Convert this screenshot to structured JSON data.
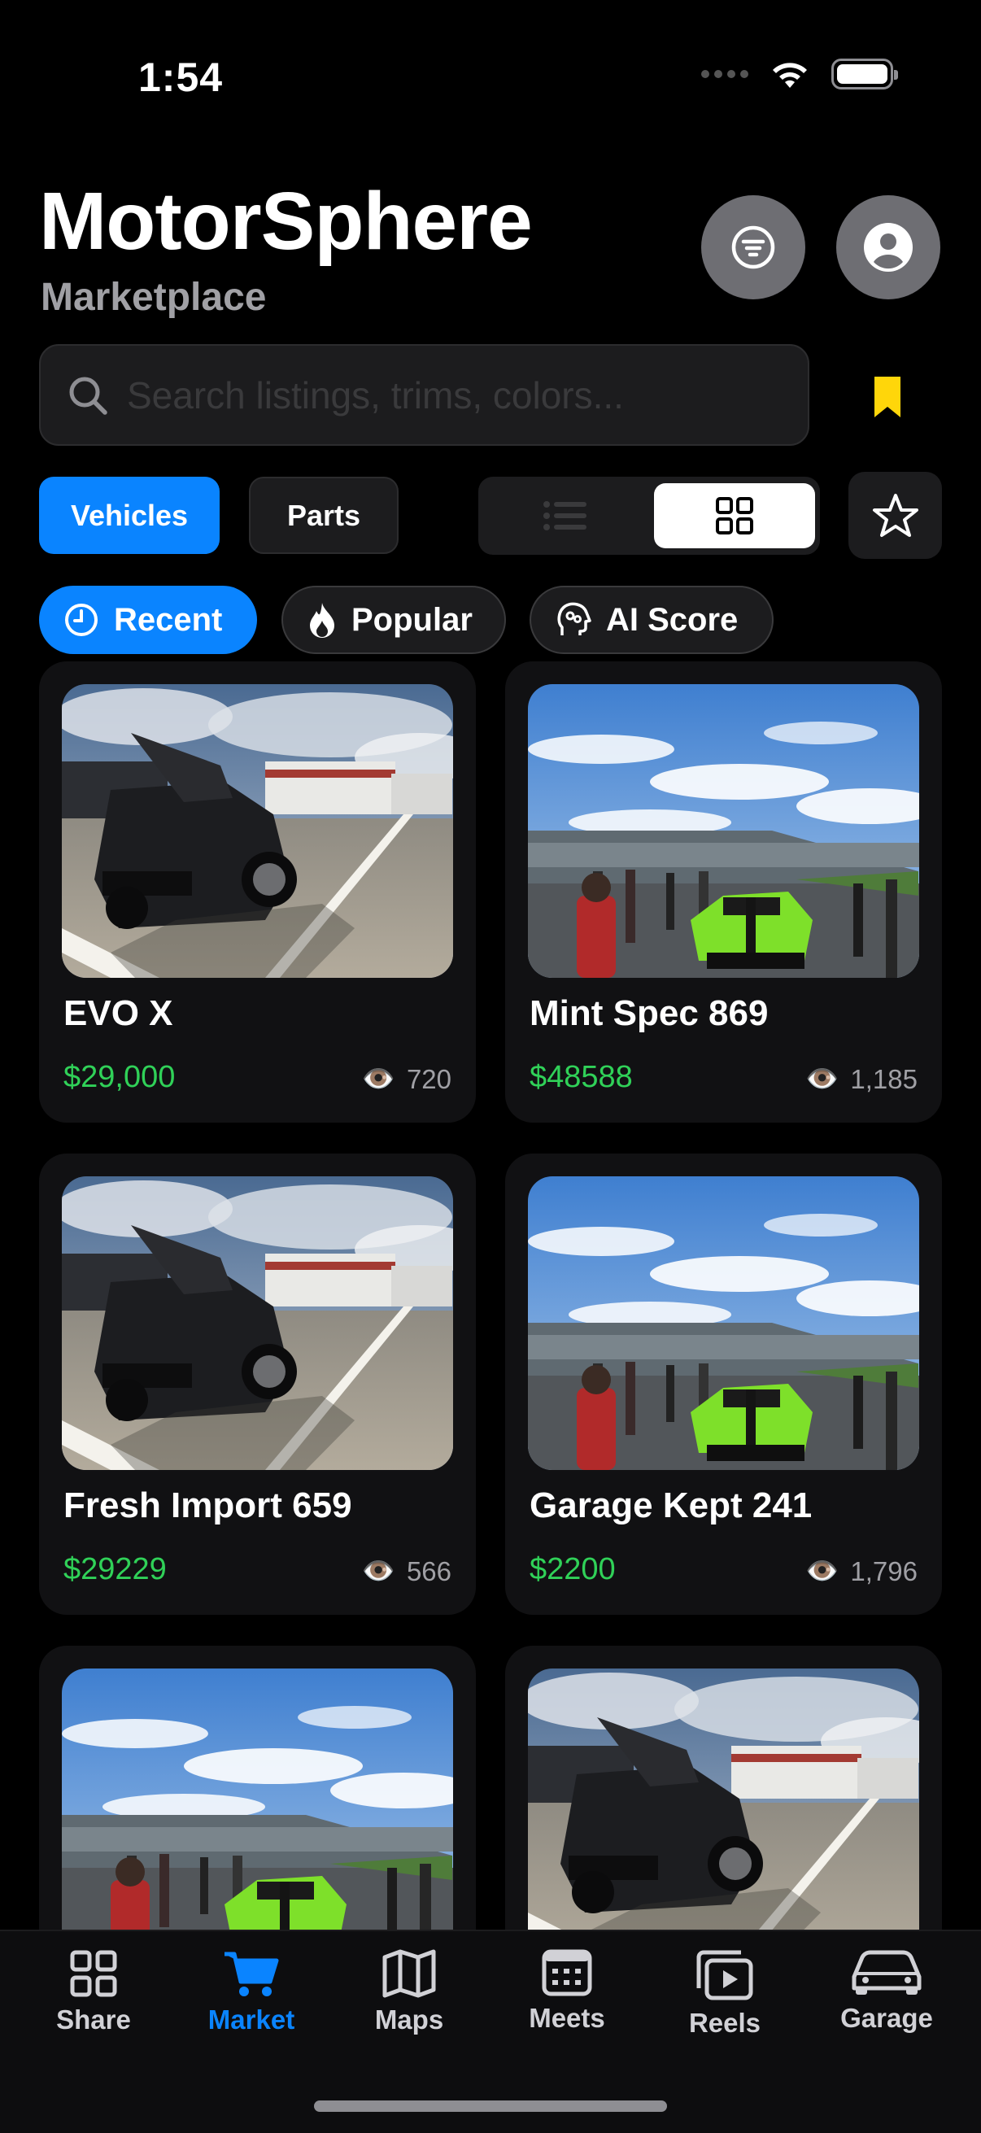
{
  "status_bar": {
    "time": "1:54"
  },
  "header": {
    "title": "MotorSphere",
    "subtitle": "Marketplace"
  },
  "search": {
    "placeholder": "Search listings, trims, colors..."
  },
  "segments": {
    "vehicles": "Vehicles",
    "parts": "Parts",
    "active": "Vehicles"
  },
  "view_mode": {
    "active": "grid"
  },
  "sort_chips": [
    {
      "label": "Recent",
      "icon": "clock-icon",
      "active": true
    },
    {
      "label": "Popular",
      "icon": "flame-icon",
      "active": false
    },
    {
      "label": "AI Score",
      "icon": "brain-head-icon",
      "active": false
    }
  ],
  "listings": [
    {
      "title": "EVO X",
      "price": "$29,000",
      "views": "720",
      "photo": "black-gtr-hood-open"
    },
    {
      "title": "Mint Spec 869",
      "price": "$48588",
      "views": "1,185",
      "photo": "drag-strip-green-car"
    },
    {
      "title": "Fresh Import 659",
      "price": "$29229",
      "views": "566",
      "photo": "black-gtr-hood-open"
    },
    {
      "title": "Garage Kept 241",
      "price": "$2200",
      "views": "1,796",
      "photo": "drag-strip-green-car"
    },
    {
      "title": "",
      "price": "",
      "views": "",
      "photo": "drag-strip-green-car"
    },
    {
      "title": "",
      "price": "",
      "views": "",
      "photo": "black-gtr-hood-open"
    }
  ],
  "tabs": [
    {
      "label": "Share",
      "icon": "grid-icon",
      "active": false
    },
    {
      "label": "Market",
      "icon": "cart-icon",
      "active": true
    },
    {
      "label": "Maps",
      "icon": "map-icon",
      "active": false
    },
    {
      "label": "Meets",
      "icon": "calendar-icon",
      "active": false
    },
    {
      "label": "Reels",
      "icon": "play-icon",
      "active": false
    },
    {
      "label": "Garage",
      "icon": "car-icon",
      "active": false
    }
  ],
  "colors": {
    "accent": "#0a84ff",
    "price": "#30d158",
    "bookmark": "#ffd60a",
    "background": "#000000"
  }
}
